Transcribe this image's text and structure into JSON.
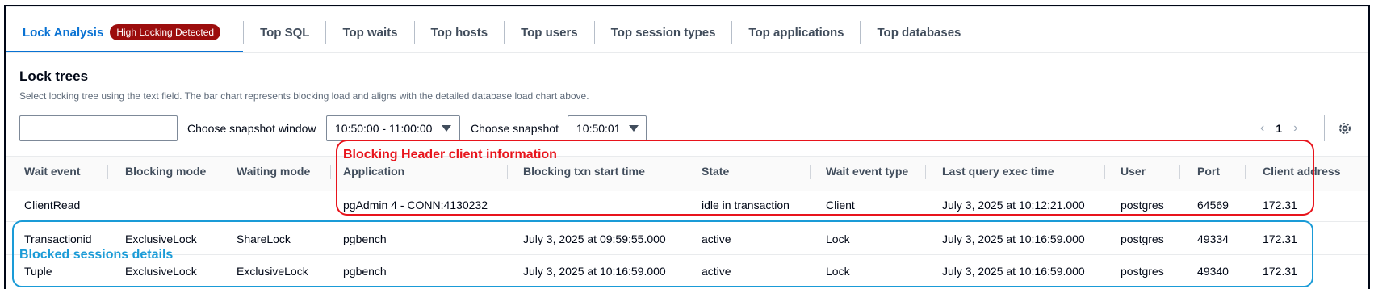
{
  "tabs": [
    {
      "label": "Lock Analysis",
      "badge": "High Locking Detected",
      "active": true
    },
    {
      "label": "Top SQL"
    },
    {
      "label": "Top waits"
    },
    {
      "label": "Top hosts"
    },
    {
      "label": "Top users"
    },
    {
      "label": "Top session types"
    },
    {
      "label": "Top applications"
    },
    {
      "label": "Top databases"
    }
  ],
  "section": {
    "title": "Lock trees",
    "description": "Select locking tree using the text field. The bar chart represents blocking load and aligns with the detailed database load chart above."
  },
  "filters": {
    "search_value": "",
    "snapshot_window_label": "Choose snapshot window",
    "snapshot_window_value": "10:50:00 - 11:00:00",
    "snapshot_label": "Choose snapshot",
    "snapshot_value": "10:50:01"
  },
  "pagination": {
    "current_page": "1",
    "prev": "‹",
    "next": "›"
  },
  "table": {
    "columns": [
      "Wait event",
      "Blocking mode",
      "Waiting mode",
      "Application",
      "Blocking txn start time",
      "State",
      "Wait event type",
      "Last query exec time",
      "User",
      "Port",
      "Client address"
    ],
    "rows": [
      [
        "ClientRead",
        "",
        "",
        "pgAdmin 4 - CONN:4130232",
        "",
        "idle in transaction",
        "Client",
        "July 3, 2025 at 10:12:21.000",
        "postgres",
        "64569",
        "172.31"
      ],
      [
        "Transactionid",
        "ExclusiveLock",
        "ShareLock",
        "pgbench",
        "July 3, 2025 at 09:59:55.000",
        "active",
        "Lock",
        "July 3, 2025 at 10:16:59.000",
        "postgres",
        "49334",
        "172.31"
      ],
      [
        "Tuple",
        "ExclusiveLock",
        "ExclusiveLock",
        "pgbench",
        "July 3, 2025 at 10:16:59.000",
        "active",
        "Lock",
        "July 3, 2025 at 10:16:59.000",
        "postgres",
        "49340",
        "172.31"
      ]
    ]
  },
  "annotations": {
    "header_label": "Blocking Header client information",
    "blocked_label": "Blocked sessions details",
    "header_color": "#e8141c",
    "blocked_color": "#1a9bd7"
  },
  "colors": {
    "accent": "#0972d3",
    "badge": "#9c0d0d"
  },
  "icons": {
    "search": "search-icon",
    "settings": "gear-icon",
    "dropdown": "caret-down-icon"
  }
}
